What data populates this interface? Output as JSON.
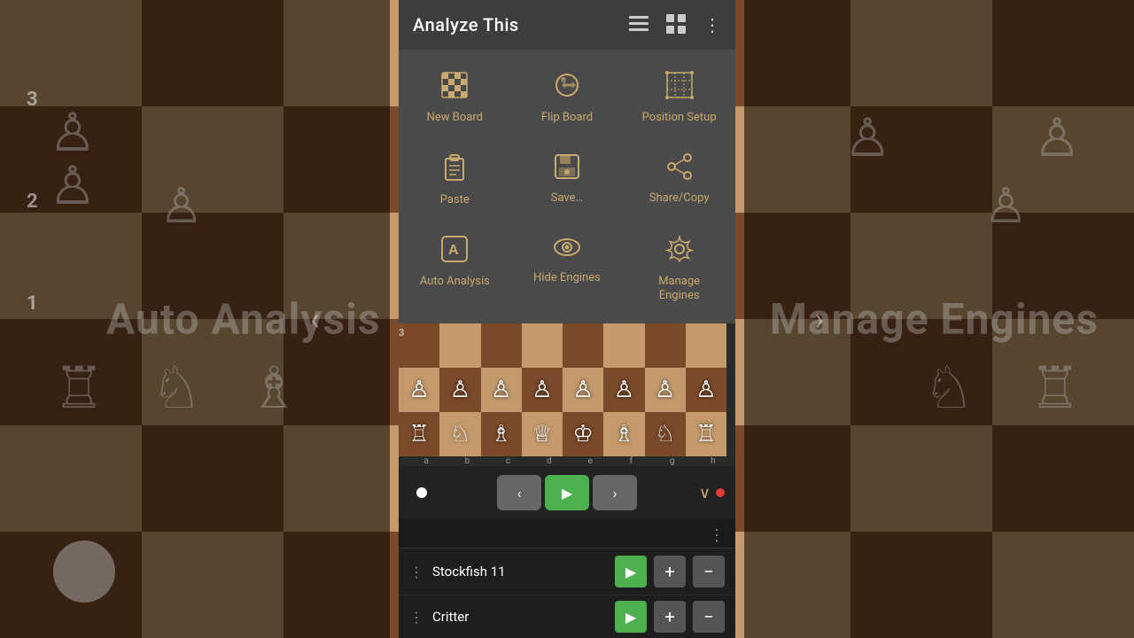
{
  "app": {
    "title": "Analyze This",
    "background_left_text": "Auto Analysis",
    "background_right_text": "Manage Engines"
  },
  "header": {
    "title": "Analyze This",
    "icon_list": "☰",
    "icon_grid": "⊞",
    "icon_more": "⋮"
  },
  "menu": {
    "rows": [
      [
        {
          "id": "new-board",
          "label": "New Board",
          "icon": "chess_board"
        },
        {
          "id": "flip-board",
          "label": "Flip Board",
          "icon": "flip"
        },
        {
          "id": "position-setup",
          "label": "Position Setup",
          "icon": "grid_setup"
        }
      ],
      [
        {
          "id": "paste",
          "label": "Paste",
          "icon": "clipboard"
        },
        {
          "id": "save",
          "label": "Save…",
          "icon": "save"
        },
        {
          "id": "share-copy",
          "label": "Share/Copy",
          "icon": "share"
        }
      ],
      [
        {
          "id": "auto-analysis",
          "label": "Auto Analysis",
          "icon": "auto_a"
        },
        {
          "id": "hide-engines",
          "label": "Hide Engines",
          "icon": "eye"
        },
        {
          "id": "manage-engines",
          "label": "Manage Engines",
          "icon": "gear"
        }
      ]
    ]
  },
  "board": {
    "rank_labels": [
      "3",
      "2",
      "1"
    ],
    "pawns_row": [
      "♙",
      "♙",
      "♙",
      "♙",
      "♙",
      "♙",
      "♙",
      "♙"
    ],
    "pieces_row": [
      "♖",
      "♘",
      "♗",
      "♕",
      "♔",
      "♗",
      "♘",
      "♖"
    ]
  },
  "controls": {
    "prev_label": "‹",
    "play_label": "▶",
    "next_label": "›"
  },
  "engine1": {
    "name": "Stockfish 11",
    "play": "▶",
    "plus": "+",
    "minus": "−"
  },
  "engine2": {
    "name": "Critter",
    "play": "▶",
    "plus": "+",
    "minus": "−"
  },
  "movelist": {
    "three_dot": "⋮"
  }
}
